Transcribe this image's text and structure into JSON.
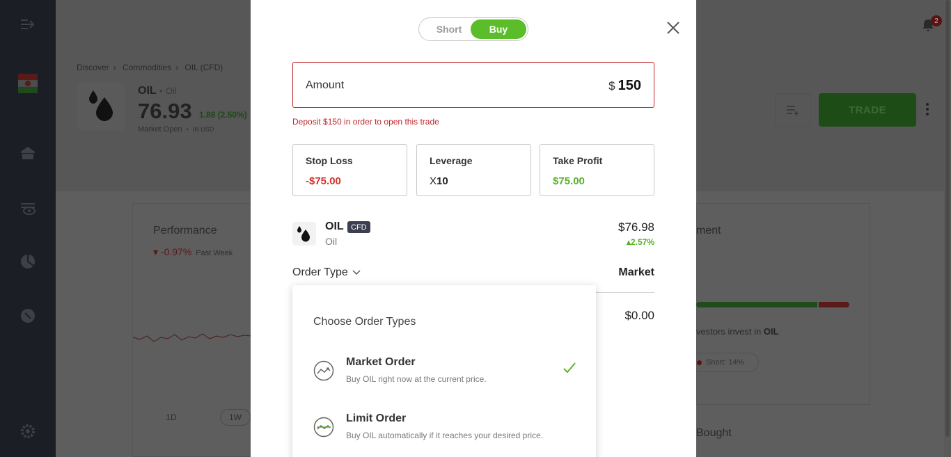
{
  "sidebar": {
    "icons": [
      "expand-arrow-icon",
      "flag-icon",
      "home-icon",
      "watchlist-icon",
      "portfolio-icon",
      "discover-icon",
      "settings-icon"
    ]
  },
  "background": {
    "breadcrumb": [
      "Discover",
      "Commodities",
      "OIL (CFD)"
    ],
    "symbol": "OIL",
    "symbol_name": "Oil",
    "price": "76.93",
    "change": "1.88 (2.50%)",
    "market_status": "Market Open",
    "currency_note": "IN USD",
    "performance_title": "Performance",
    "performance_value": "-0.97%",
    "performance_period": "Past Week",
    "timeframes": [
      "1D",
      "1W"
    ],
    "trade_button": "TRADE",
    "notification_count": "2",
    "right_title": "ment",
    "investors_text": "vestors invest in",
    "investors_symbol": "OIL",
    "short_label": "Short:",
    "short_value": "14%",
    "bought_text": "Bought"
  },
  "modal": {
    "toggle": {
      "short": "Short",
      "buy": "Buy",
      "selected": "Buy"
    },
    "amount": {
      "label": "Amount",
      "currency": "$",
      "value": "150"
    },
    "deposit_warning": "Deposit $150 in order to open this trade",
    "stop_loss": {
      "label": "Stop Loss",
      "value": "-$75.00"
    },
    "leverage": {
      "label": "Leverage",
      "prefix": "X",
      "value": "10"
    },
    "take_profit": {
      "label": "Take Profit",
      "value": "$75.00"
    },
    "instrument": {
      "symbol": "OIL",
      "badge": "CFD",
      "name": "Oil",
      "price": "$76.98",
      "change": "2.57%"
    },
    "order_type": {
      "label": "Order Type",
      "value": "Market"
    },
    "units_value": "$0.00",
    "dropdown": {
      "title": "Choose Order Types",
      "options": [
        {
          "title": "Market Order",
          "desc": "Buy OIL right now at the current price.",
          "selected": true
        },
        {
          "title": "Limit Order",
          "desc": "Buy OIL automatically if it reaches your desired price.",
          "selected": false
        }
      ]
    }
  },
  "colors": {
    "buy_green": "#5bbd2a",
    "error_red": "#c0272d",
    "loss_red": "#d6312d",
    "profit_green": "#5bb02a"
  }
}
